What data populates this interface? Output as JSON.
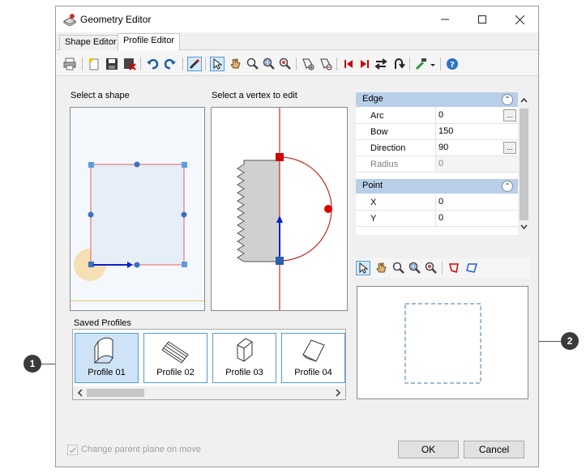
{
  "window": {
    "title": "Geometry Editor"
  },
  "tabs": [
    {
      "label": "Shape Editor"
    },
    {
      "label": "Profile Editor"
    }
  ],
  "captions": {
    "select_shape": "Select a shape",
    "select_vertex": "Select a vertex to edit",
    "saved_profiles": "Saved Profiles"
  },
  "properties": {
    "edge": {
      "title": "Edge",
      "rows": [
        {
          "name": "Arc",
          "value": "0"
        },
        {
          "name": "Bow",
          "value": "150"
        },
        {
          "name": "Direction",
          "value": "90"
        },
        {
          "name": "Radius",
          "value": "0"
        }
      ]
    },
    "point": {
      "title": "Point",
      "rows": [
        {
          "name": "X",
          "value": "0"
        },
        {
          "name": "Y",
          "value": "0"
        }
      ]
    }
  },
  "profiles": [
    "Profile 01",
    "Profile 02",
    "Profile 03",
    "Profile 04"
  ],
  "footer": {
    "checkbox_label": "Change parent plane on move",
    "ok": "OK",
    "cancel": "Cancel"
  },
  "callouts": [
    "1",
    "2"
  ],
  "colors": {
    "accent": "#0078d7",
    "shape_edge": "#e06060",
    "vertex": "#3b6fbf",
    "selected_vertex": "#e00000",
    "category": "#b8cfe8"
  }
}
